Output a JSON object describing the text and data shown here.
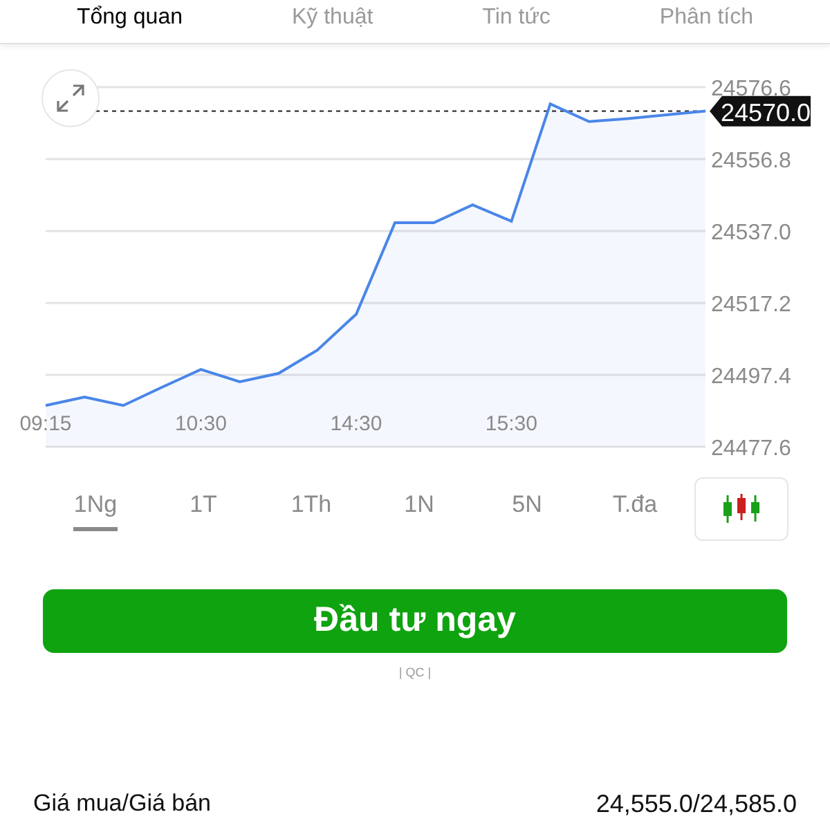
{
  "tabs": [
    {
      "label": "Tổng quan",
      "selected": true
    },
    {
      "label": "Kỹ thuật",
      "selected": false
    },
    {
      "label": "Tin tức",
      "selected": false
    },
    {
      "label": "Phân tích",
      "selected": false
    }
  ],
  "chart": {
    "chart_data": {
      "type": "area",
      "categories": [
        "09:15",
        null,
        null,
        null,
        "10:30",
        null,
        null,
        null,
        "14:30",
        null,
        null,
        null,
        "15:30",
        null,
        null,
        null,
        null,
        null
      ],
      "series": [
        {
          "color": "#4a86e8",
          "values": [
            24489.0,
            24491.3,
            24489.0,
            24494.0,
            24498.9,
            24495.5,
            24497.8,
            24504.2,
            24514.1,
            24539.3,
            24539.3,
            24544.2,
            24539.7,
            24572.0,
            24567.1,
            24567.9,
            24569.0,
            24570.0
          ]
        }
      ],
      "ylim": [
        24477.6,
        24576.6
      ],
      "yticks": [
        {
          "value": 24576.6,
          "label": "24576.6"
        },
        {
          "value": 24556.8,
          "label": "24556.8"
        },
        {
          "value": 24537.0,
          "label": "24537.0"
        },
        {
          "value": 24517.2,
          "label": "24517.2"
        },
        {
          "value": 24497.4,
          "label": "24497.4"
        },
        {
          "value": 24477.6,
          "label": "24477.6"
        }
      ],
      "grid": true,
      "ref_lines": [
        {
          "axis": "y",
          "value": 24570.0,
          "label": "24570.0"
        }
      ]
    }
  },
  "periods": [
    {
      "label": "1Ng",
      "selected": true
    },
    {
      "label": "1T",
      "selected": false
    },
    {
      "label": "1Th",
      "selected": false
    },
    {
      "label": "1N",
      "selected": false
    },
    {
      "label": "5N",
      "selected": false
    },
    {
      "label": "T.đa",
      "selected": false
    }
  ],
  "invest_button": "Đầu tư ngay",
  "ad_label": "| QC |",
  "bid_ask": {
    "label": "Giá mua/Giá bán",
    "value": "24,555.0/24,585.0"
  }
}
